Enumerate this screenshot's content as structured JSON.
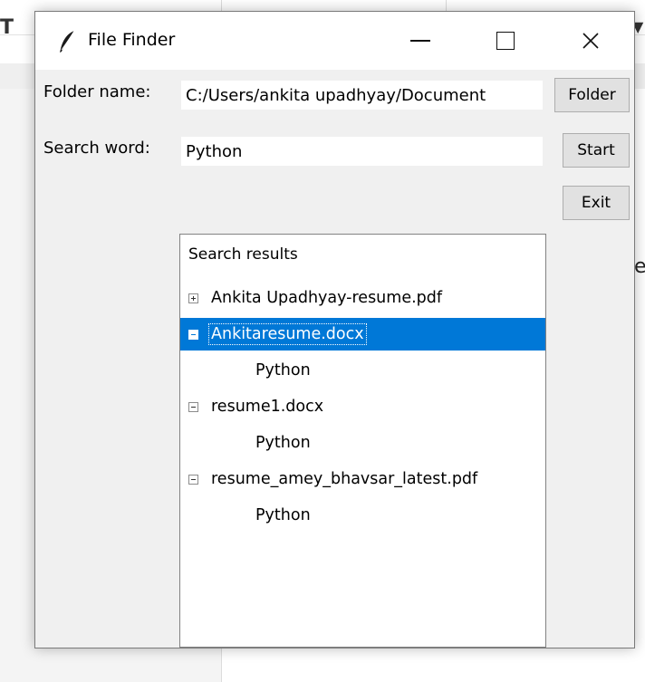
{
  "window": {
    "title": "File Finder",
    "controls": {
      "minimize": "—",
      "maximize": "☐",
      "close": "✕"
    }
  },
  "form": {
    "folder_label": "Folder name:",
    "folder_value": "C:/Users/ankita upadhyay/Document",
    "search_label": "Search word:",
    "search_value": "Python"
  },
  "buttons": {
    "folder": "Folder",
    "start": "Start",
    "exit": "Exit"
  },
  "results": {
    "heading": "Search results",
    "items": [
      {
        "label": "Ankita Upadhyay-resume.pdf",
        "expanded": false,
        "selected": false,
        "children": []
      },
      {
        "label": "Ankitaresume.docx",
        "expanded": true,
        "selected": true,
        "children": [
          "Python"
        ]
      },
      {
        "label": "resume1.docx",
        "expanded": true,
        "selected": false,
        "children": [
          "Python"
        ]
      },
      {
        "label": "resume_amey_bhavsar_latest.pdf",
        "expanded": true,
        "selected": false,
        "children": [
          "Python"
        ]
      }
    ]
  },
  "colors": {
    "selection": "#0078d7",
    "window_bg": "#f0f0f0",
    "accent": "#0078d7"
  },
  "icons": [
    "feather-icon",
    "minimize-icon",
    "maximize-icon",
    "close-icon",
    "expand-icon",
    "collapse-icon"
  ]
}
